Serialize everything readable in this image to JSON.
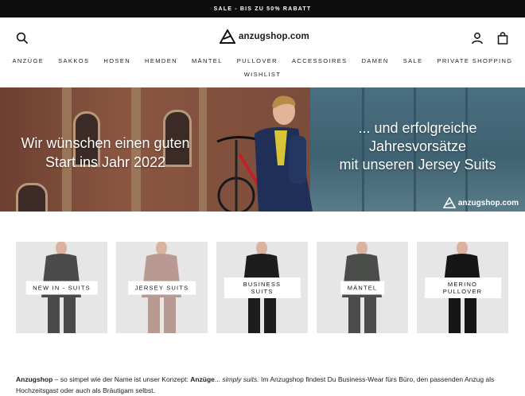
{
  "topbar": {
    "text": "SALE - BIS ZU 50% RABATT"
  },
  "header": {
    "logo_text": "anzugshop.com",
    "icons": [
      "search-icon",
      "account-icon",
      "cart-icon"
    ]
  },
  "nav": {
    "row1": [
      "ANZÜGE",
      "SAKKOS",
      "HOSEN",
      "HEMDEN",
      "MÄNTEL",
      "PULLOVER",
      "ACCESSOIRES",
      "DAMEN",
      "SALE",
      "PRIVATE SHOPPING"
    ],
    "row2": [
      "WISHLIST"
    ]
  },
  "hero": {
    "left_line1": "Wir wünschen einen guten",
    "left_line2": "Start ins Jahr 2022",
    "right_line1": "... und erfolgreiche",
    "right_line2": "Jahresvorsätze",
    "right_line3": "mit unseren Jersey Suits",
    "brand": "anzugshop.com"
  },
  "tiles": [
    {
      "label": "NEW IN - SUITS",
      "color": "#4a4a4a"
    },
    {
      "label": "JERSEY SUITS",
      "color": "#b99a93"
    },
    {
      "label": "BUSINESS SUITS",
      "color": "#1d1d1d"
    },
    {
      "label": "MÄNTEL",
      "color": "#4b4d4b"
    },
    {
      "label": "MERINO PULLOVER",
      "color": "#161616"
    }
  ],
  "about": {
    "brand": "Anzugshop",
    "text1": " – so simpel wie der Name ist unser Konzept: ",
    "emph": "Anzüge",
    "dots": "...",
    "italic": " simply suits.",
    "text2": " Im Anzugshop findest Du Business-Wear fürs Büro, den passenden Anzug als Hochzeitsgast oder auch als Bräutigam selbst."
  }
}
